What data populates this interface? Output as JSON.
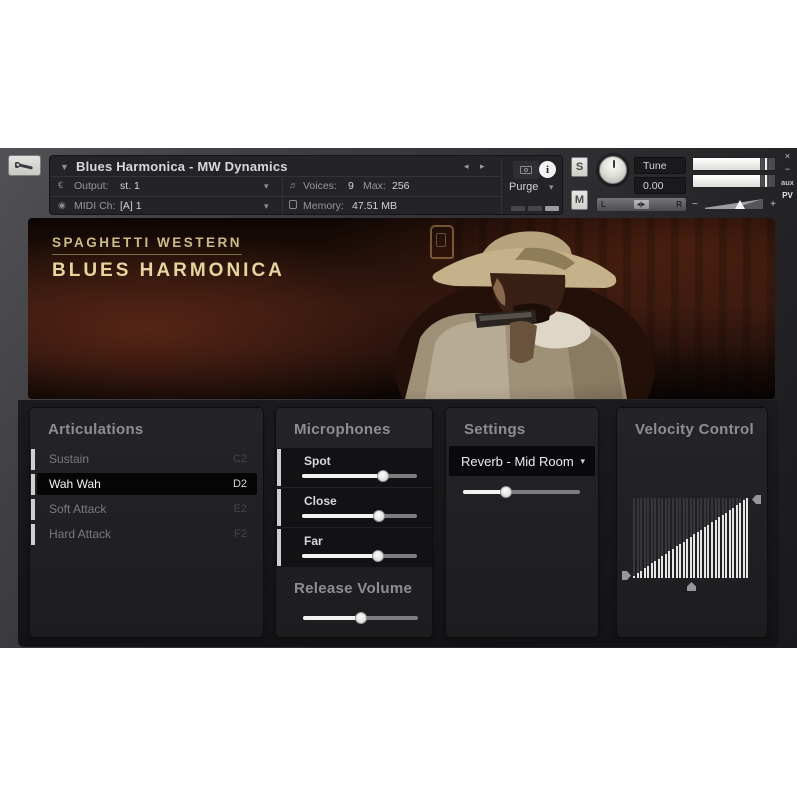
{
  "icons": {
    "title_caret": "▼",
    "dd_caret": "▾",
    "nav_left": "◂",
    "nav_right": "▸",
    "info": "i",
    "output_glyph": "€",
    "midi_glyph": "◉",
    "voices_glyph": "♬",
    "pan_marker": "◂|▸"
  },
  "header": {
    "instrument_title": "Blues Harmonica - MW Dynamics",
    "output_label": "Output:",
    "output_value": "st. 1",
    "midi_label": "MIDI Ch:",
    "midi_value": "[A] 1",
    "voices_label": "Voices:",
    "voices_value": "9",
    "max_label": "Max:",
    "max_value": "256",
    "memory_label": "Memory:",
    "memory_value": "47.51 MB",
    "purge_label": "Purge",
    "solo_label": "S",
    "mute_label": "M",
    "tune_label": "Tune",
    "tune_value": "0.00",
    "pan_left": "L",
    "pan_right": "R",
    "vol_minus": "−",
    "vol_plus": "+",
    "close_label": "×",
    "minimize_label": "−",
    "aux_label": "aux",
    "pv_label": "PV"
  },
  "artwork": {
    "series": "SPAGHETTI WESTERN",
    "product": "BLUES HARMONICA"
  },
  "panels": {
    "articulations": {
      "title": "Articulations",
      "items": [
        {
          "label": "Sustain",
          "key": "C2",
          "selected": false
        },
        {
          "label": "Wah Wah",
          "key": "D2",
          "selected": true
        },
        {
          "label": "Soft Attack",
          "key": "E2",
          "selected": false
        },
        {
          "label": "Hard Attack",
          "key": "F2",
          "selected": false
        }
      ]
    },
    "microphones": {
      "title": "Microphones",
      "sliders": [
        {
          "label": "Spot",
          "value": 70
        },
        {
          "label": "Close",
          "value": 67
        },
        {
          "label": "Far",
          "value": 66
        }
      ]
    },
    "release": {
      "title": "Release Volume",
      "value": 50
    },
    "settings": {
      "title": "Settings",
      "dropdown_value": "Reverb - Mid Room",
      "slider_value": 37
    },
    "velocity": {
      "title": "Velocity Control",
      "bars": 33,
      "min_pct": 3,
      "max_pct": 100,
      "curve": "linear"
    }
  },
  "colors": {
    "accent_gold": "#e7d5a0",
    "panel_title": "#8e8e92",
    "selected_row_bg": "#050505",
    "slider_fill": "#f2f2f0",
    "meter_fill": "#ffffff"
  }
}
